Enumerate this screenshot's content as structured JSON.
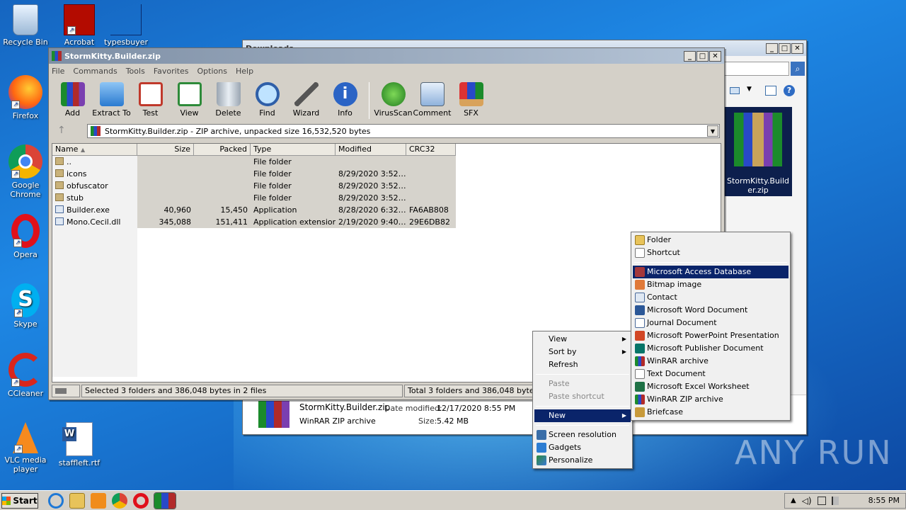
{
  "desktop": {
    "icons": [
      {
        "label": "Recycle Bin",
        "icon": "recycle-bin-icon"
      },
      {
        "label": "Acrobat",
        "icon": "acrobat-icon"
      },
      {
        "label": "typesbuyer",
        "icon": "blank-file-icon"
      },
      {
        "label": "Firefox",
        "icon": "firefox-icon"
      },
      {
        "label": "Google Chrome",
        "icon": "chrome-icon"
      },
      {
        "label": "Opera",
        "icon": "opera-icon"
      },
      {
        "label": "Skype",
        "icon": "skype-icon"
      },
      {
        "label": "CCleaner",
        "icon": "ccleaner-icon"
      },
      {
        "label": "VLC media player",
        "icon": "vlc-icon"
      },
      {
        "label": "staffleft.rtf",
        "icon": "word-doc-icon"
      }
    ],
    "watermark": "ANY RUN"
  },
  "explorer": {
    "title": "Downloads",
    "file_name": "StormKitty.Builder.zip",
    "file_type": "WinRAR ZIP archive",
    "date_label": "Date modified:",
    "date_value": "12/17/2020 8:55 PM",
    "size_label": "Size:",
    "size_value": "5.42 MB",
    "preview_label": "StormKitty.Builder.zip"
  },
  "winrar": {
    "title": "StormKitty.Builder.zip",
    "menu": [
      "File",
      "Commands",
      "Tools",
      "Favorites",
      "Options",
      "Help"
    ],
    "tools": [
      {
        "label": "Add",
        "icon": "add-archive-icon"
      },
      {
        "label": "Extract To",
        "icon": "extract-folder-icon"
      },
      {
        "label": "Test",
        "icon": "test-clipboard-icon"
      },
      {
        "label": "View",
        "icon": "view-book-icon"
      },
      {
        "label": "Delete",
        "icon": "delete-bin-icon"
      },
      {
        "label": "Find",
        "icon": "find-magnifier-icon"
      },
      {
        "label": "Wizard",
        "icon": "wizard-wand-icon"
      },
      {
        "label": "Info",
        "icon": "info-icon"
      },
      {
        "label": "VirusScan",
        "icon": "virus-scan-icon"
      },
      {
        "label": "Comment",
        "icon": "comment-icon"
      },
      {
        "label": "SFX",
        "icon": "sfx-box-icon"
      }
    ],
    "address": "StormKitty.Builder.zip - ZIP archive, unpacked size 16,532,520 bytes",
    "columns": [
      "Name",
      "Size",
      "Packed",
      "Type",
      "Modified",
      "CRC32"
    ],
    "rows": [
      {
        "name": "..",
        "size": "",
        "packed": "",
        "type": "File folder",
        "modified": "",
        "crc": ""
      },
      {
        "name": "icons",
        "size": "",
        "packed": "",
        "type": "File folder",
        "modified": "8/29/2020 3:52…",
        "crc": ""
      },
      {
        "name": "obfuscator",
        "size": "",
        "packed": "",
        "type": "File folder",
        "modified": "8/29/2020 3:52…",
        "crc": ""
      },
      {
        "name": "stub",
        "size": "",
        "packed": "",
        "type": "File folder",
        "modified": "8/29/2020 3:52…",
        "crc": ""
      },
      {
        "name": "Builder.exe",
        "size": "40,960",
        "packed": "15,450",
        "type": "Application",
        "modified": "8/28/2020 6:32…",
        "crc": "FA6AB808"
      },
      {
        "name": "Mono.Cecil.dll",
        "size": "345,088",
        "packed": "151,411",
        "type": "Application extension",
        "modified": "2/19/2020 9:40…",
        "crc": "29E6DB82"
      }
    ],
    "status_left": "Selected 3 folders and 386,048 bytes in 2 files",
    "status_right": "Total 3 folders and 386,048 bytes in 2"
  },
  "context_menu": {
    "items": [
      "View",
      "Sort by",
      "Refresh",
      "Paste",
      "Paste shortcut",
      "New",
      "Screen resolution",
      "Gadgets",
      "Personalize"
    ]
  },
  "new_submenu": {
    "items": [
      "Folder",
      "Shortcut",
      "Microsoft Access Database",
      "Bitmap image",
      "Contact",
      "Microsoft Word Document",
      "Journal Document",
      "Microsoft PowerPoint Presentation",
      "Microsoft Publisher Document",
      "WinRAR archive",
      "Text Document",
      "Microsoft Excel Worksheet",
      "WinRAR ZIP archive",
      "Briefcase"
    ]
  },
  "taskbar": {
    "start": "Start",
    "clock": "8:55 PM"
  }
}
